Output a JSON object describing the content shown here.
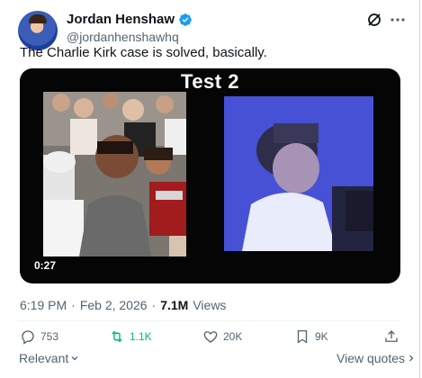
{
  "author": {
    "name": "Jordan Henshaw",
    "handle": "@jordanhenshawhq",
    "verified_color": "#1d9bf0"
  },
  "tweet": {
    "text": "The Charlie Kirk case is solved, basically."
  },
  "media": {
    "title": "Test 2",
    "duration": "0:27",
    "left_image_caption": "crowd-scene",
    "right_image_caption": "stage-scene"
  },
  "meta": {
    "time": "6:19 PM",
    "separator": "·",
    "date": "Feb 2, 2026",
    "views_count": "7.1M",
    "views_label": "Views"
  },
  "actions": {
    "reply_count": "753",
    "retweet_count": "1.1K",
    "like_count": "20K",
    "bookmark_count": "9K",
    "retweet_color": "#00ba7c"
  },
  "footer": {
    "relevant_label": "Relevant",
    "view_quotes_label": "View quotes"
  }
}
